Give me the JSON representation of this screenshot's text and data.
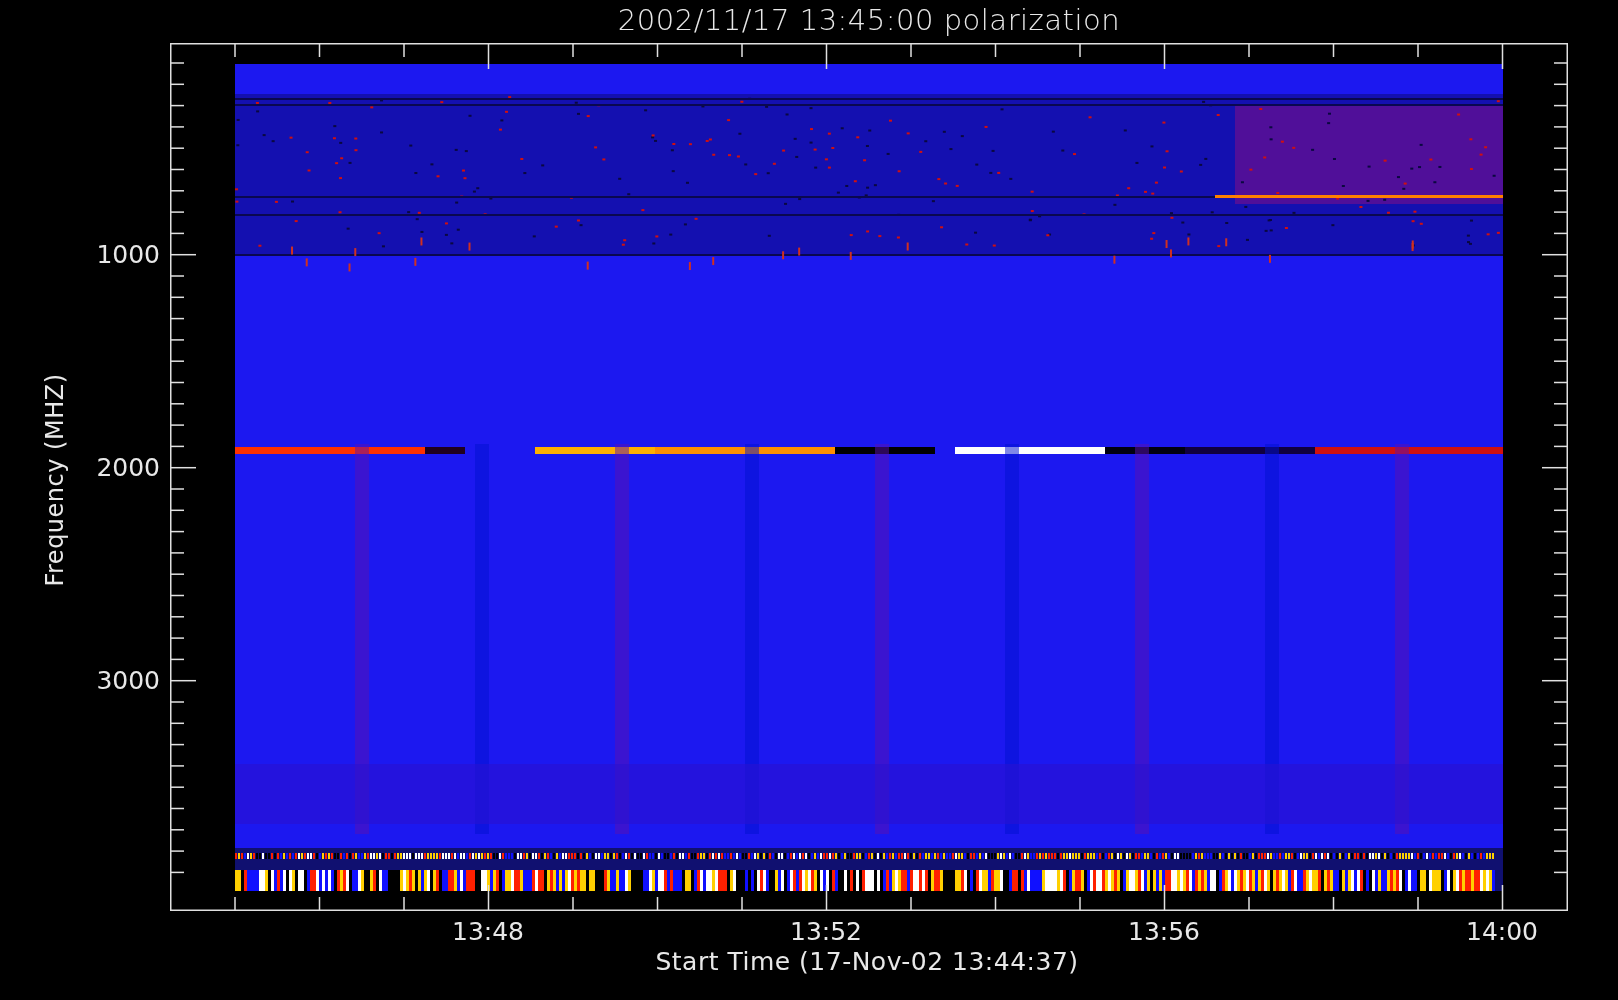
{
  "title": "2002/11/17 13:45:00 polarization",
  "y_axis": {
    "label": "Frequency (MHZ)",
    "ticks": [
      "1000",
      "2000",
      "3000"
    ]
  },
  "x_axis": {
    "label": "Start Time (17-Nov-02 13:44:37)",
    "ticks": [
      "13:48",
      "13:52",
      "13:56",
      "14:00"
    ]
  }
}
